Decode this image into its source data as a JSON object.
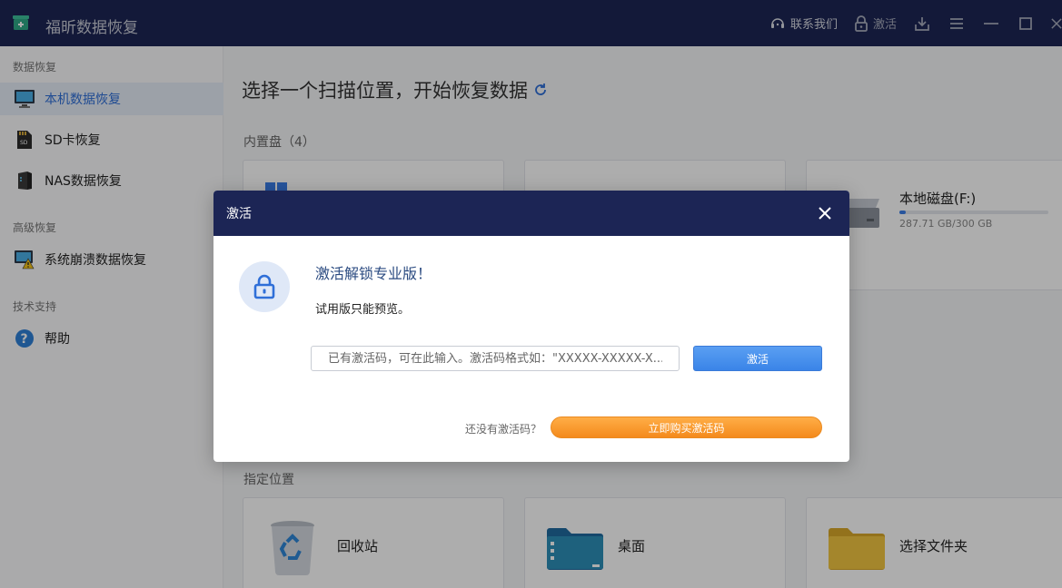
{
  "app": {
    "title": "福昕数据恢复"
  },
  "titlebar": {
    "contact": "联系我们",
    "activate": "激活"
  },
  "sidebar": {
    "sections": [
      {
        "label": "数据恢复",
        "items": [
          {
            "label": "本机数据恢复",
            "icon": "monitor-icon",
            "active": true
          },
          {
            "label": "SD卡恢复",
            "icon": "sd-card-icon"
          },
          {
            "label": "NAS数据恢复",
            "icon": "nas-icon"
          }
        ]
      },
      {
        "label": "高级恢复",
        "items": [
          {
            "label": "系统崩溃数据恢复",
            "icon": "system-crash-icon"
          }
        ]
      },
      {
        "label": "技术支持",
        "items": [
          {
            "label": "帮助",
            "icon": "help-icon"
          }
        ]
      }
    ]
  },
  "main": {
    "title": "选择一个扫描位置，开始恢复数据",
    "internal_label": "内置盘（4）",
    "drives": [
      {
        "name": "本地磁盘(F:)",
        "size": "287.71 GB/300 GB",
        "used_fraction": 0.04
      }
    ],
    "specified_label": "指定位置",
    "locations": [
      {
        "label": "回收站",
        "icon": "recycle-bin-icon"
      },
      {
        "label": "桌面",
        "icon": "desktop-folder-icon"
      },
      {
        "label": "选择文件夹",
        "icon": "folder-icon"
      }
    ]
  },
  "dialog": {
    "header": "激活",
    "title": "激活解锁专业版！",
    "description": "试用版只能预览。",
    "input_placeholder": "已有激活码，可在此输入。激活码格式如：\"XXXXX-XXXXX-X...",
    "activate_button": "激活",
    "no_code_text": "还没有激活码？",
    "buy_button": "立即购买激活码"
  },
  "colors": {
    "titlebar": "#1c2555",
    "accent": "#3a84e8",
    "buy": "#f48a1c"
  }
}
